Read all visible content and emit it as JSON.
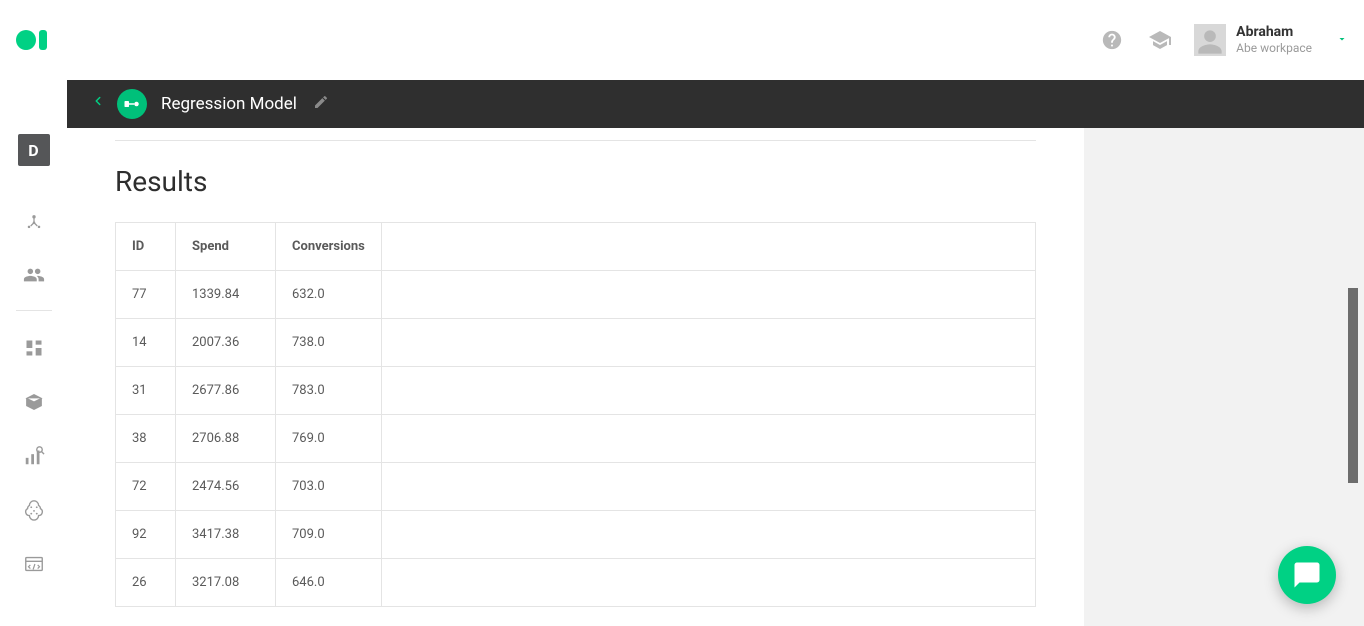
{
  "header": {
    "user_name": "Abraham",
    "workspace": "Abe workpace"
  },
  "sidebar": {
    "badge": "D"
  },
  "titlebar": {
    "title": "Regression Model"
  },
  "results": {
    "section_title": "Results",
    "columns": [
      "ID",
      "Spend",
      "Conversions"
    ],
    "rows": [
      {
        "id": "77",
        "spend": "1339.84",
        "conversions": "632.0"
      },
      {
        "id": "14",
        "spend": "2007.36",
        "conversions": "738.0"
      },
      {
        "id": "31",
        "spend": "2677.86",
        "conversions": "783.0"
      },
      {
        "id": "38",
        "spend": "2706.88",
        "conversions": "769.0"
      },
      {
        "id": "72",
        "spend": "2474.56",
        "conversions": "703.0"
      },
      {
        "id": "92",
        "spend": "3417.38",
        "conversions": "709.0"
      },
      {
        "id": "26",
        "spend": "3217.08",
        "conversions": "646.0"
      }
    ]
  },
  "colors": {
    "accent": "#00d184",
    "titlebar_bg": "#2f2f2f"
  }
}
